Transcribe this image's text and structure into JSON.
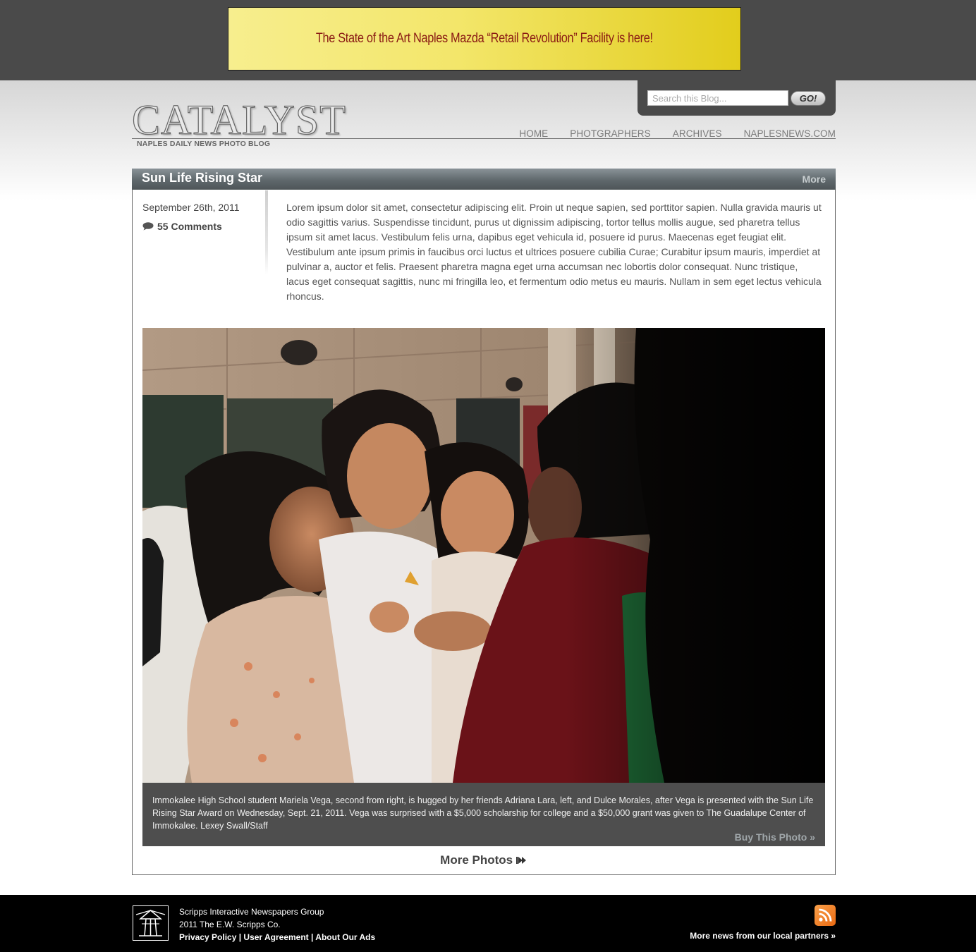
{
  "ad": {
    "text": "The State of the Art Naples Mazda “Retail Revolution” Facility is here!"
  },
  "search": {
    "placeholder": "Search this Blog...",
    "button_label": "GO!"
  },
  "site": {
    "logo_text": "CATALYST",
    "subtitle": "NAPLES DAILY NEWS PHOTO BLOG"
  },
  "nav": {
    "items": [
      {
        "label": "HOME"
      },
      {
        "label": "PHOTGRAPHERS"
      },
      {
        "label": "ARCHIVES"
      },
      {
        "label": "NAPLESNEWS.COM"
      }
    ]
  },
  "post": {
    "title": "Sun Life Rising Star",
    "more_label": "More",
    "date": "September 26th, 2011",
    "comments": "55 Comments",
    "body": "Lorem ipsum dolor sit amet, consectetur adipiscing elit. Proin ut neque sapien, sed porttitor sapien. Nulla gravida mauris ut odio sagittis varius. Suspendisse tincidunt, purus ut dignissim adipiscing, tortor tellus mollis augue, sed pharetra tellus ipsum sit amet lacus. Vestibulum felis urna, dapibus eget vehicula id, posuere id purus. Maecenas eget feugiat elit. Vestibulum ante ipsum primis in faucibus orci luctus et ultrices posuere cubilia Curae; Curabitur ipsum mauris, imperdiet at pulvinar a, auctor et felis. Praesent pharetra magna eget urna accumsan nec lobortis dolor consequat. Nunc tristique, lacus eget consequat sagittis, nunc mi fringilla leo, et fermentum odio metus eu mauris. Nullam in sem eget lectus vehicula rhoncus.",
    "caption": "Immokalee High School student Mariela Vega, second from right, is hugged by her friends Adriana Lara, left, and Dulce Morales, after Vega is presented with the Sun Life Rising Star Award on Wednesday, Sept. 21, 2011. Vega was surprised with a $5,000 scholarship for college and a $50,000 grant was given to The Guadalupe Center of Immokalee. Lexey Swall/Staff",
    "buy_label": "Buy This Photo »",
    "more_photos_label": "More Photos"
  },
  "footer": {
    "line1": "Scripps Interactive Newspapers Group",
    "line2": "2011 The E.W. Scripps Co.",
    "links": [
      {
        "label": "Privacy Policy"
      },
      {
        "label": "User Agreement"
      },
      {
        "label": "About Our Ads"
      }
    ],
    "more_news": "More news from our local partners »"
  },
  "icons": {
    "comment": "speech-bubble-icon",
    "more_photos_arrow": "double-arrow-right-icon",
    "rss": "rss-feed-icon",
    "footer_logo": "scripps-lighthouse-logo"
  },
  "colors": {
    "top_band": "#4a4a4a",
    "ad_text": "#8a1a14",
    "title_bar": "#5f686c",
    "caption_bg": "#4e4e4e",
    "footer_bg": "#000000",
    "rss_orange": "#ea6a12"
  }
}
